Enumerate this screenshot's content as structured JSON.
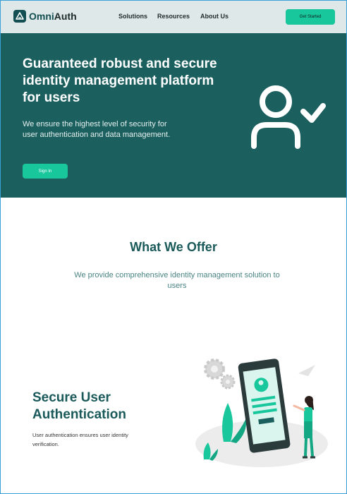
{
  "nav": {
    "brand_prefix": "Omni",
    "brand_suffix": "Auth",
    "links": [
      "Solutions",
      "Resources",
      "About Us"
    ],
    "cta_label": "Get Started"
  },
  "hero": {
    "title": "Guaranteed robust and secure identity management platform for users",
    "subtitle": "We ensure the highest level of security for user authentication and data management.",
    "signin_label": "Sign In"
  },
  "offer": {
    "title": "What We Offer",
    "subtitle": "We provide comprehensive identity management solution to users"
  },
  "feature": {
    "title": "Secure User Authentication",
    "description": "User authentication ensures user identity verification."
  },
  "colors": {
    "accent": "#19c79d",
    "brand_dark": "#1c5f5f",
    "nav_bg": "#dfe8e8"
  },
  "icons": [
    "omniauth-logo-icon",
    "user-check-icon",
    "phone-authentication-illustration"
  ]
}
